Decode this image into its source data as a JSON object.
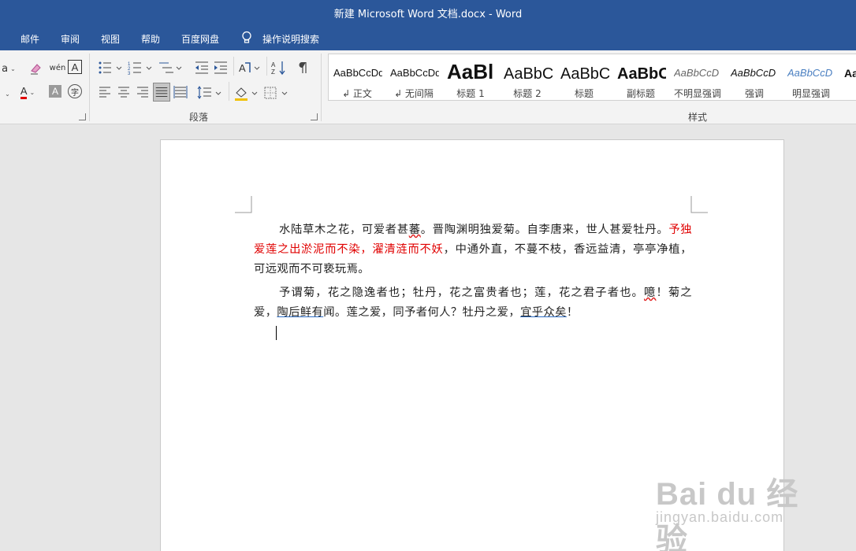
{
  "window": {
    "title": "新建 Microsoft Word 文档.docx  -  Word"
  },
  "menu": {
    "tabs": [
      "邮件",
      "审阅",
      "视图",
      "帮助",
      "百度网盘"
    ],
    "tell_me": "操作说明搜索"
  },
  "ribbon": {
    "paragraph_group_label": "段落",
    "styles_group_label": "样式",
    "font_partial": "a",
    "styles": [
      {
        "sample": "AaBbCcDd",
        "label": "↲ 正文"
      },
      {
        "sample": "AaBbCcDd",
        "label": "↲ 无间隔"
      },
      {
        "sample": "AaBl",
        "label": "标题 1"
      },
      {
        "sample": "AaBbC",
        "label": "标题 2"
      },
      {
        "sample": "AaBbC",
        "label": "标题"
      },
      {
        "sample": "AaBbC",
        "label": "副标题"
      },
      {
        "sample": "AaBbCcD",
        "label": "不明显强调"
      },
      {
        "sample": "AaBbCcD",
        "label": "强调"
      },
      {
        "sample": "AaBbCcD",
        "label": "明显强调"
      },
      {
        "sample": "Aa",
        "label": ""
      }
    ]
  },
  "document": {
    "p1": {
      "t1": "水陆草木之花，可爱者甚",
      "t1_sq": "蕃",
      "t2": "。晋陶渊明独爱菊。自李唐来，世人甚爱牡丹。",
      "red": "予独爱莲之出淤泥而不染，濯清涟而不妖",
      "t3": "，中通外直，不蔓不枝，香远益清，亭亭净植，可远观而不可亵玩焉。"
    },
    "p2": {
      "t1": "予谓菊，花之隐逸者也；牡丹，花之富贵者也；莲，花之君子者也。",
      "sq": "噫",
      "t2": "！菊之爱，",
      "u1": "陶后鲜有",
      "t3": "闻。莲之爱，同予者何人？牡丹之爱，",
      "u2": "宜乎众矣",
      "t4": "！"
    }
  },
  "watermark": {
    "brand": "Bai du 经验",
    "url": "jingyan.baidu.com"
  }
}
